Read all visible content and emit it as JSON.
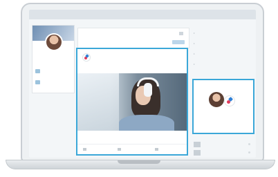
{
  "topbar": {
    "text": ""
  },
  "profile": {
    "name": "",
    "subtitle": "",
    "rows": [
      {
        "text": ""
      },
      {
        "text": ""
      }
    ]
  },
  "composer": {
    "placeholder": ""
  },
  "post": {
    "author": "",
    "meta": "",
    "text": "",
    "link": "",
    "caption": "",
    "stats": "",
    "actions": [
      {
        "label": ""
      },
      {
        "label": ""
      },
      {
        "label": ""
      }
    ]
  },
  "news": {
    "title": "",
    "items": [
      "",
      "",
      "",
      ""
    ]
  },
  "ad": {
    "label": "",
    "text": "",
    "cta": ""
  },
  "right_list": {
    "title": "",
    "items": [
      "",
      ""
    ]
  },
  "colors": {
    "accent": "#3aa7d8",
    "logo_red": "#e23b5c",
    "logo_blue": "#2f80d6"
  }
}
